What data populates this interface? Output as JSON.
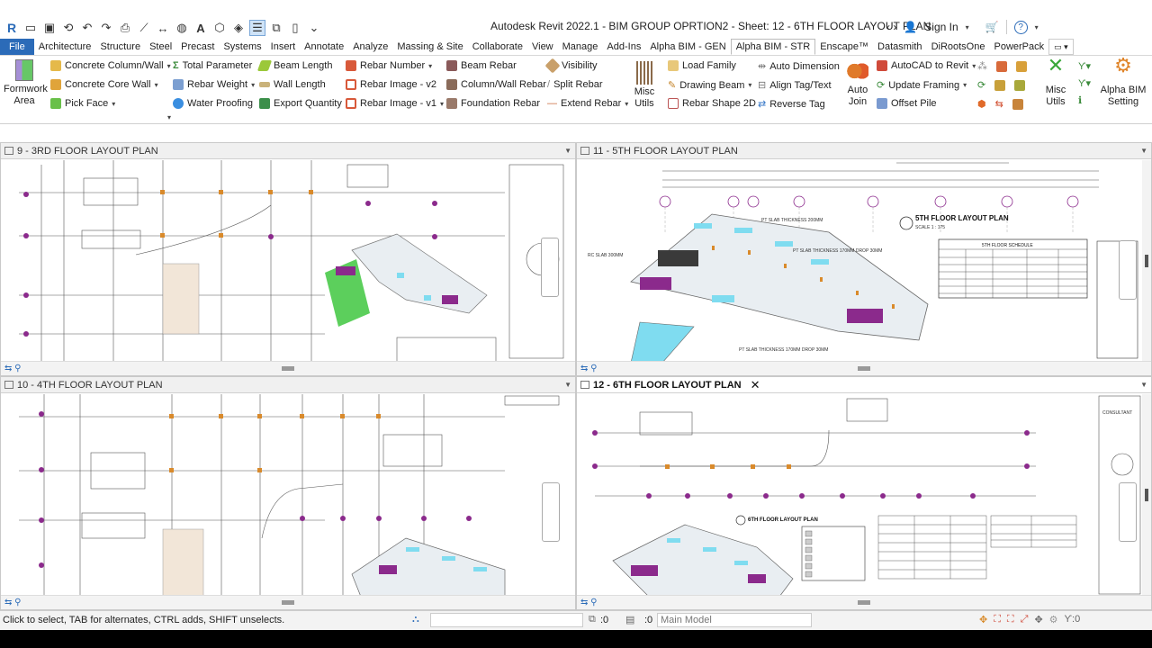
{
  "window": {
    "title": "Autodesk Revit 2022.1 - BIM GROUP OPRTION2 - Sheet: 12 - 6TH FLOOR LAYOUT PLAN",
    "sign_in": "Sign In",
    "help": "?"
  },
  "tabs": [
    "File",
    "Architecture",
    "Structure",
    "Steel",
    "Precast",
    "Systems",
    "Insert",
    "Annotate",
    "Analyze",
    "Massing & Site",
    "Collaborate",
    "View",
    "Manage",
    "Add-Ins",
    "Alpha BIM - GEN",
    "Alpha BIM - STR",
    "Enscape™",
    "Datasmith",
    "DiRootsOne",
    "PowerPack"
  ],
  "active_tab": "Alpha BIM - STR",
  "ribbon": {
    "formwork_area": "Formwork Area",
    "concrete_column_wall": "Concrete Column/Wall",
    "concrete_core_wall": "Concrete Core Wall",
    "pick_face": "Pick Face",
    "total_parameter": "Total Parameter",
    "rebar_weight": "Rebar Weight",
    "water_proofing": "Water Proofing",
    "beam_length": "Beam Length",
    "wall_length": "Wall Length",
    "export_quantity": "Export Quantity",
    "rebar_number": "Rebar Number",
    "rebar_image_v2": "Rebar Image - v2",
    "rebar_image_v1": "Rebar Image - v1",
    "beam_rebar": "Beam Rebar",
    "column_wall_rebar": "Column/Wall Rebar",
    "foundation_rebar": "Foundation Rebar",
    "visibility": "Visibility",
    "split_rebar": "Split Rebar",
    "extend_rebar": "Extend Rebar",
    "misc_utils": "Misc Utils",
    "load_family": "Load Family",
    "drawing_beam": "Drawing Beam",
    "rebar_shape_2d": "Rebar Shape 2D",
    "auto_dimension": "Auto Dimension",
    "align_tag_text": "Align Tag/Text",
    "reverse_tag": "Reverse Tag",
    "auto_join": "Auto Join",
    "autocad_to_revit": "AutoCAD to Revit",
    "update_framing": "Update Framing",
    "offset_pile": "Offset Pile",
    "misc_utils_2": "Misc Utils",
    "alpha_bim_setting": "Alpha BIM Setting"
  },
  "views": {
    "v9": "9 - 3RD FLOOR LAYOUT PLAN",
    "v11": "11 - 5TH FLOOR LAYOUT PLAN",
    "v10": "10 - 4TH FLOOR LAYOUT PLAN",
    "v12": "12 - 6TH FLOOR LAYOUT PLAN"
  },
  "drawing_labels": {
    "fifth_floor_title": "5TH FLOOR LAYOUT PLAN",
    "fifth_floor_scale": "SCALE 1 : 175",
    "fifth_schedule_title": "5TH FLOOR SCHEDULE",
    "pt_slab_200": "PT SLAB THICKNESS 200MM",
    "pt_slab_170_drop30": "PT SLAB THICKNESS 170MM DROP 30MM",
    "rc_slab_300": "RC SLAB 300MM",
    "pt_slab_170_drop30_b": "PT SLAB THICKNESS 170MM DROP 30MM",
    "sixth_floor_title": "6TH FLOOR LAYOUT PLAN",
    "consultant": "CONSULTANT"
  },
  "status": {
    "message": "Click to select, TAB for alternates, CTRL adds, SHIFT unselects.",
    "zero_a": ":0",
    "zero_b": ":0",
    "model": "Main Model"
  },
  "colors": {
    "file_tab": "#2b6bb8",
    "slab_cyan": "#7fdcf0",
    "wall_magenta": "#8b2a8c",
    "column_orange": "#d98a2b",
    "green_slab": "#3fc73f"
  }
}
